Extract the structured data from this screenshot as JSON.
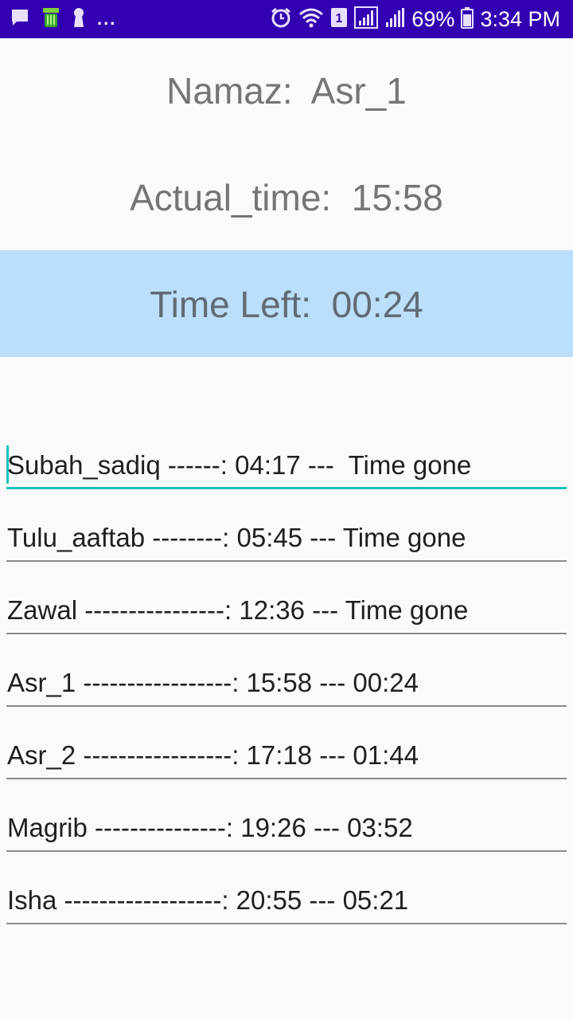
{
  "status_bar": {
    "left_icons": [
      "message-icon",
      "trash-can-icon",
      "keyhole-icon"
    ],
    "overflow": "...",
    "right_icons": [
      "alarm-icon",
      "wifi-icon",
      "sim-1-icon",
      "signal-icon",
      "signal-icon"
    ],
    "battery_percent": "69%",
    "time": "3:34 PM",
    "color": "#3200b0"
  },
  "header": {
    "namaz_label": "Namaz:",
    "namaz_value": "Asr_1",
    "actual_label": "Actual_time:",
    "actual_value": "15:58",
    "time_left_label": "Time Left:",
    "time_left_value": "00:24",
    "panel_color": "#bbdefb"
  },
  "prayers": [
    {
      "text": "Subah_sadiq ------: 04:17 ---  Time gone"
    },
    {
      "text": "Tulu_aaftab --------: 05:45 --- Time gone"
    },
    {
      "text": "Zawal ----------------: 12:36 --- Time gone"
    },
    {
      "text": "Asr_1 -----------------: 15:58 --- 00:24"
    },
    {
      "text": "Asr_2 -----------------: 17:18 --- 01:44"
    },
    {
      "text": "Magrib ---------------: 19:26 --- 03:52"
    },
    {
      "text": "Isha ------------------: 20:55 --- 05:21"
    }
  ],
  "accent_color": "#19c4b8"
}
